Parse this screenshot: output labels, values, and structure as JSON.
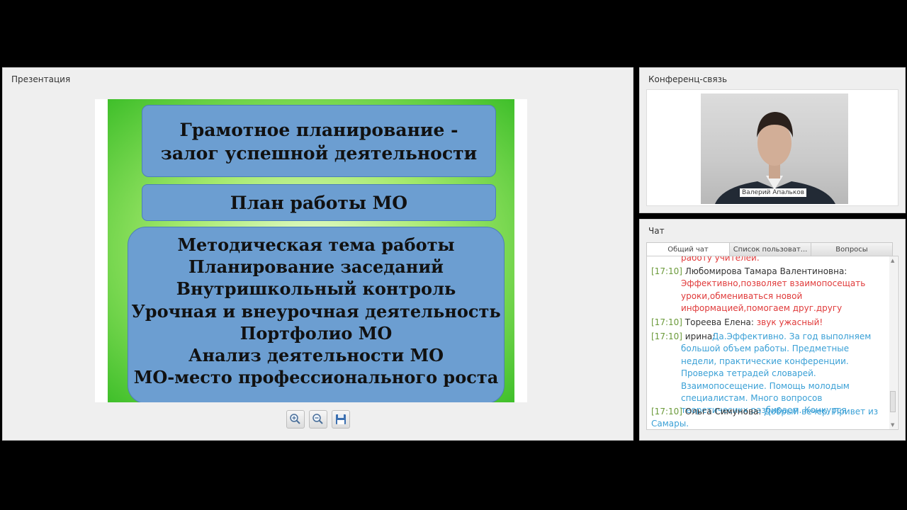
{
  "presentation": {
    "title": "Презентация",
    "slide": {
      "title_line1": "Грамотное планирование -",
      "title_line2": "залог успешной деятельности",
      "subtitle": "План работы МО",
      "items": [
        "Методическая тема работы",
        "Планирование заседаний",
        "Внутришкольный контроль",
        "Урочная и внеурочная деятельность",
        "Портфолио МО",
        "Анализ деятельности МО",
        "МО-место профессионального роста"
      ]
    },
    "toolbar": {
      "zoom_in": "zoom-in-icon",
      "zoom_out": "zoom-out-icon",
      "save": "save-icon"
    }
  },
  "conference": {
    "title": "Конференц-связь",
    "participant_name": "Валерий Апальков"
  },
  "chat": {
    "title": "Чат",
    "tabs": [
      "Общий чат",
      "Список пользоват...",
      "Вопросы"
    ],
    "messages": [
      {
        "time": "",
        "author": "",
        "text": "работу учителей."
      },
      {
        "time": "[17:10]",
        "author": "Любомирова Тамара Валентиновна:",
        "text": "Эффективно,позволяет взаимопосещать уроки,обмениваться новой информацией,помогаем друг.другу"
      },
      {
        "time": "[17:10]",
        "author": "Тореева Елена:",
        "text": "звук ужасный!"
      },
      {
        "time": "[17:10]",
        "author": "ирина:",
        "text": "Да.Эффективно. За год выполняем большой объем работы. Предметные недели, практические конференции. Проверка тетрадей словарей. Взаимопосещение. Помощь молодым специалистам. Много вопросов теоретичесикх разбираем. Конкурся"
      },
      {
        "time": "[17:10]",
        "author": "Ольга Симунова:",
        "text": "Добрый вечер. Привет из Самары."
      }
    ],
    "colors": {
      "time": "#6b9a3a",
      "red": "#e03a3a",
      "blue": "#3aa0d6"
    }
  }
}
